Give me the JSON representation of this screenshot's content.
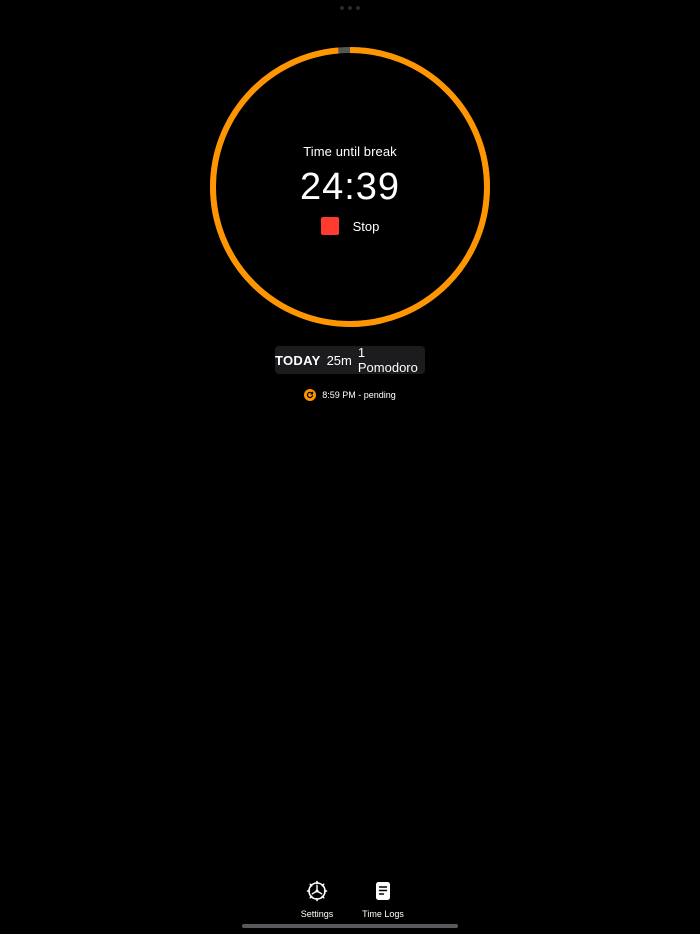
{
  "timer": {
    "label": "Time until break",
    "value": "24:39",
    "progress_fraction": 0.986,
    "stop_label": "Stop"
  },
  "summary": {
    "today_label": "TODAY",
    "duration": "25m",
    "pomodoro_count": "1 Pomodoro"
  },
  "log_entry": {
    "icon": "refresh-icon",
    "text": "8:59 PM - pending"
  },
  "tabs": [
    {
      "label": "Settings",
      "icon": "gear-icon"
    },
    {
      "label": "Time Logs",
      "icon": "document-icon"
    }
  ],
  "colors": {
    "accent": "#ff9500",
    "stop": "#ff3b30",
    "ring_track": "#555555",
    "background": "#000000"
  }
}
